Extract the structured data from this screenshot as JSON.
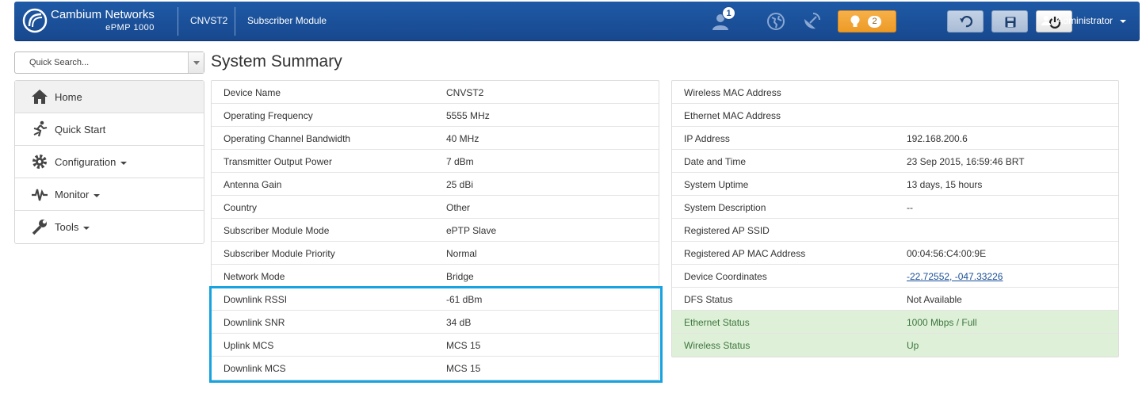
{
  "header": {
    "brand_name": "Cambium Networks",
    "brand_model": "ePMP 1000",
    "device": "CNVST2",
    "mode": "Subscriber Module",
    "users_badge": "1",
    "alerts_badge": "2",
    "user_label": "Administrator"
  },
  "search": {
    "placeholder": "Quick Search..."
  },
  "nav": {
    "items": [
      {
        "label": "Home"
      },
      {
        "label": "Quick Start"
      },
      {
        "label": "Configuration"
      },
      {
        "label": "Monitor"
      },
      {
        "label": "Tools"
      }
    ]
  },
  "page": {
    "title": "System Summary"
  },
  "left_table": [
    {
      "label": "Device Name",
      "value": "CNVST2"
    },
    {
      "label": "Operating Frequency",
      "value": "5555 MHz"
    },
    {
      "label": "Operating Channel Bandwidth",
      "value": "40 MHz"
    },
    {
      "label": "Transmitter Output Power",
      "value": "7 dBm"
    },
    {
      "label": "Antenna Gain",
      "value": "25 dBi"
    },
    {
      "label": "Country",
      "value": "Other"
    },
    {
      "label": "Subscriber Module Mode",
      "value": "ePTP Slave"
    },
    {
      "label": "Subscriber Module Priority",
      "value": "Normal"
    },
    {
      "label": "Network Mode",
      "value": "Bridge"
    },
    {
      "label": "Downlink RSSI",
      "value": "-61 dBm"
    },
    {
      "label": "Downlink SNR",
      "value": "34 dB"
    },
    {
      "label": "Uplink MCS",
      "value": "MCS 15"
    },
    {
      "label": "Downlink MCS",
      "value": "MCS 15"
    }
  ],
  "right_table": [
    {
      "label": "Wireless MAC Address",
      "value": ""
    },
    {
      "label": "Ethernet MAC Address",
      "value": ""
    },
    {
      "label": "IP Address",
      "value": "192.168.200.6"
    },
    {
      "label": "Date and Time",
      "value": "23 Sep 2015, 16:59:46 BRT"
    },
    {
      "label": "System Uptime",
      "value": "13 days, 15 hours"
    },
    {
      "label": "System Description",
      "value": "--"
    },
    {
      "label": "Registered AP SSID",
      "value": ""
    },
    {
      "label": "Registered AP MAC Address",
      "value": "00:04:56:C4:00:9E"
    },
    {
      "label": "Device Coordinates",
      "value": "-22.72552, -047.33226"
    },
    {
      "label": "DFS Status",
      "value": "Not Available"
    },
    {
      "label": "Ethernet Status",
      "value": "1000 Mbps / Full"
    },
    {
      "label": "Wireless Status",
      "value": "Up"
    }
  ],
  "colors": {
    "header_blue": "#1a4f97",
    "alert_orange": "#f0a030",
    "highlight_blue": "#17a3df",
    "status_green_bg": "#dff0d8"
  }
}
